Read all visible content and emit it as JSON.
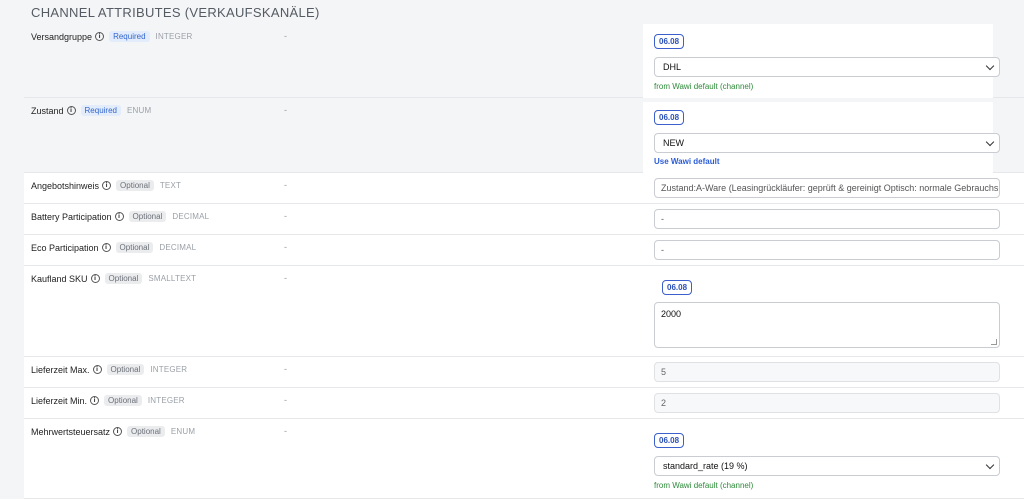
{
  "section": {
    "title": "CHANNEL ATTRIBUTES (VERKAUFSKANÄLE)"
  },
  "rows": [
    {
      "label": "Versandgruppe",
      "badge": "Required",
      "type": "INTEGER",
      "value_dash": "-",
      "chip": "06.08",
      "select_value": "DHL",
      "note": "from Wawi default (channel)"
    },
    {
      "label": "Zustand",
      "badge": "Required",
      "type": "ENUM",
      "value_dash": "-",
      "chip": "06.08",
      "select_value": "NEW",
      "note": "Use Wawi default"
    },
    {
      "label": "Angebotshinweis",
      "badge": "Optional",
      "type": "TEXT",
      "value_dash": "-",
      "input_value": "Zustand:A-Ware (Leasingrückläufer: geprüft & gereinigt Optisch: normale Gebrauchspu"
    },
    {
      "label": "Battery Participation",
      "badge": "Optional",
      "type": "DECIMAL",
      "value_dash": "-",
      "input_value": "-"
    },
    {
      "label": "Eco Participation",
      "badge": "Optional",
      "type": "DECIMAL",
      "value_dash": "-",
      "input_value": "-"
    },
    {
      "label": "Kaufland SKU",
      "badge": "Optional",
      "type": "SMALLTEXT",
      "value_dash": "-",
      "chip": "06.08",
      "textarea_value": "2000"
    },
    {
      "label": "Lieferzeit Max.",
      "badge": "Optional",
      "type": "INTEGER",
      "value_dash": "-",
      "input_value": "5"
    },
    {
      "label": "Lieferzeit Min.",
      "badge": "Optional",
      "type": "INTEGER",
      "value_dash": "-",
      "input_value": "2"
    },
    {
      "label": "Mehrwertsteuersatz",
      "badge": "Optional",
      "type": "ENUM",
      "value_dash": "-",
      "chip": "06.08",
      "select_value": "standard_rate (19 %)",
      "note": "from Wawi default (channel)"
    }
  ],
  "icons": {
    "info": "info-circle-icon",
    "chevron": "chevron-down-icon"
  },
  "colors": {
    "required_badge": "#3366cc",
    "optional_badge": "#6b7078",
    "chip_border": "#3b5fcc",
    "note_green": "#2e8b3a",
    "link_blue": "#2a5bd7"
  }
}
